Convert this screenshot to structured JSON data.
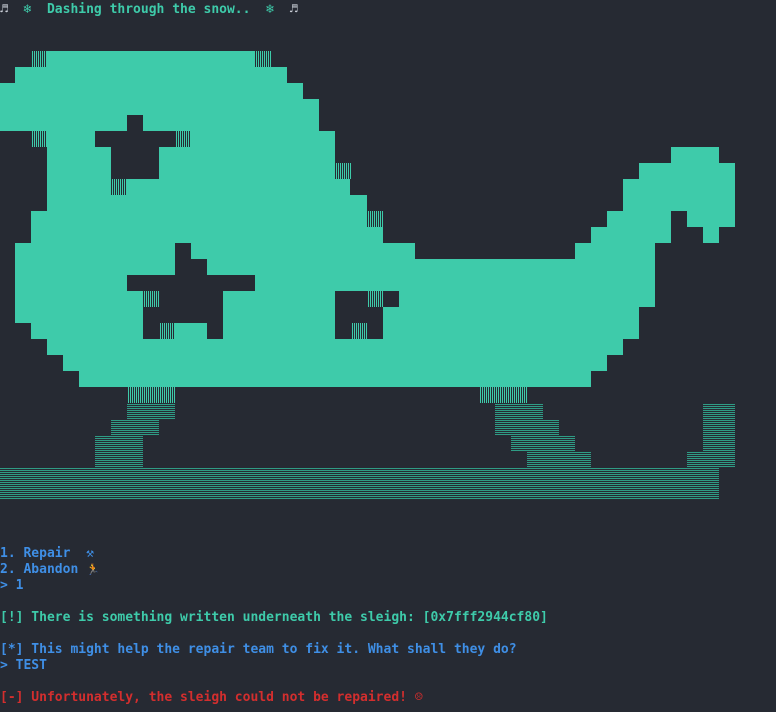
{
  "title_line": {
    "music_left": "♬",
    "snowflake_left": "❄",
    "text": "Dashing through the snow..",
    "snowflake_right": "❄",
    "music_right": "♬"
  },
  "menu": {
    "items": [
      {
        "label": "1. Repair",
        "icon": "⚒"
      },
      {
        "label": "2. Abandon",
        "icon": "🏃"
      }
    ],
    "prompt": "> 1"
  },
  "messages": {
    "info": "[!] There is something written underneath the sleigh: [0x7fff2944cf80]",
    "question": "[*] This might help the repair team to fix it. What shall they do?",
    "answer": "> TEST",
    "error": "[-] Unfortunately, the sleigh could not be repaired! ☹"
  },
  "colors": {
    "background": "#262a33",
    "sleigh": "#3ecbaa",
    "sleigh_dark": "#2f9c85",
    "info": "#3ecbaa",
    "prompt": "#3f8fe6",
    "error": "#d32e2e"
  }
}
